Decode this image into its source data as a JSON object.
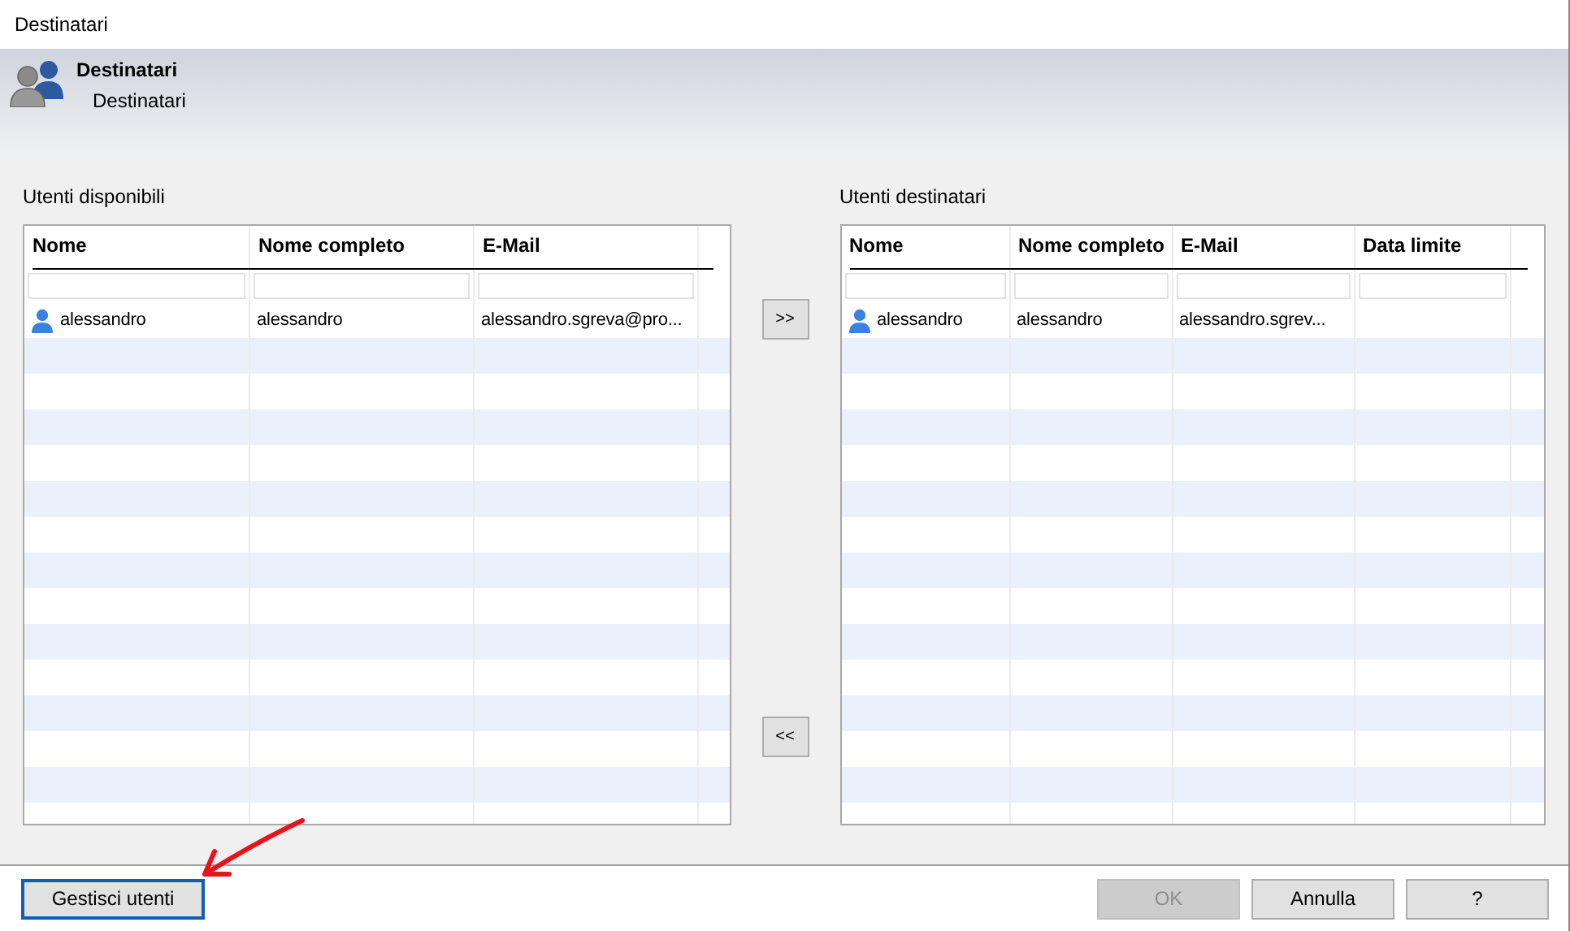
{
  "window": {
    "title": "Destinatari"
  },
  "header": {
    "title": "Destinatari",
    "subtitle": "Destinatari"
  },
  "available": {
    "label": "Utenti disponibili",
    "columns": [
      "Nome",
      "Nome completo",
      "E-Mail"
    ],
    "rows": [
      {
        "name": "alessandro",
        "full_name": "alessandro",
        "email": "alessandro.sgreva@pro..."
      }
    ]
  },
  "move_buttons": [
    ">>",
    "<<"
  ],
  "recipients": {
    "label": "Utenti destinatari",
    "columns": [
      "Nome",
      "Nome completo",
      "E-Mail",
      "Data limite"
    ],
    "rows": [
      {
        "name": "alessandro",
        "full_name": "alessandro",
        "email": "alessandro.sgrev..."
      }
    ]
  },
  "footer": {
    "manage_button": "Gestisci utenti",
    "buttons": [
      {
        "label": "OK",
        "disabled": true
      },
      {
        "label": "Annulla",
        "disabled": false
      },
      {
        "label": "?",
        "disabled": false
      }
    ]
  }
}
